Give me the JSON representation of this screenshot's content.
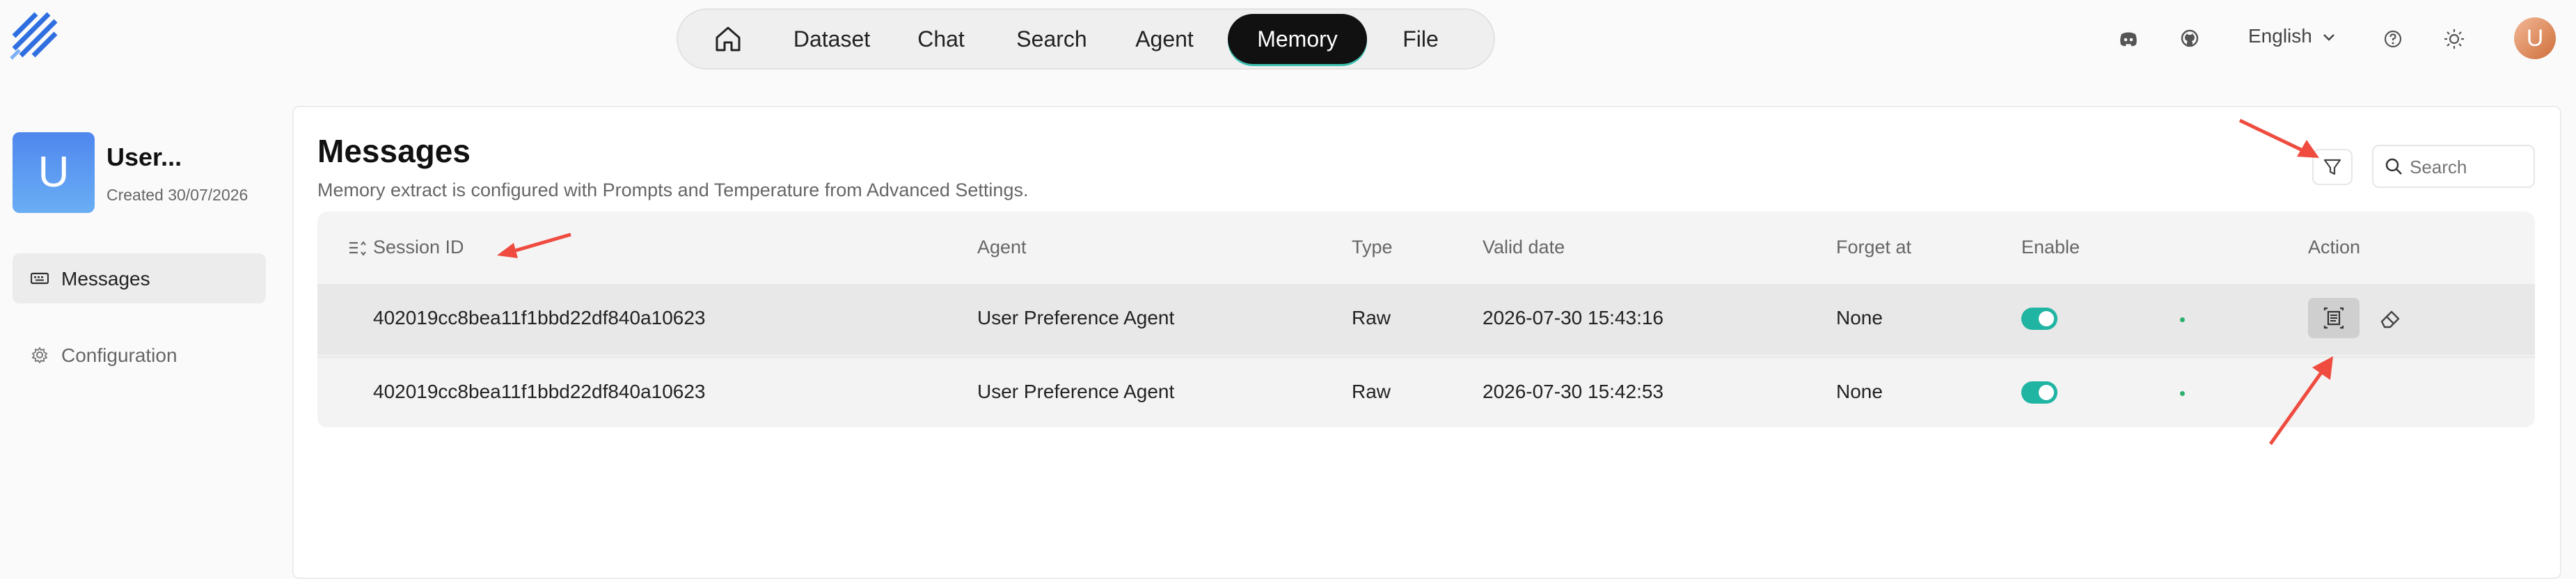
{
  "nav": {
    "items": [
      {
        "label": "Dataset"
      },
      {
        "label": "Chat"
      },
      {
        "label": "Search"
      },
      {
        "label": "Agent"
      },
      {
        "label": "Memory",
        "active": true
      },
      {
        "label": "File"
      }
    ]
  },
  "header": {
    "language": "English",
    "avatar_letter": "U"
  },
  "sidebar": {
    "avatar_letter": "U",
    "name": "User...",
    "created": "Created 30/07/2026",
    "items": [
      {
        "label": "Messages",
        "active": true
      },
      {
        "label": "Configuration",
        "active": false
      }
    ]
  },
  "main": {
    "title": "Messages",
    "subtitle": "Memory extract is configured with Prompts and Temperature from Advanced Settings.",
    "search_placeholder": "Search"
  },
  "table": {
    "headers": [
      "Session ID",
      "Agent",
      "Type",
      "Valid date",
      "Forget at",
      "Enable",
      "Action"
    ],
    "rows": [
      {
        "session_id": "402019cc8bea11f1bbd22df840a10623",
        "agent": "User Preference Agent",
        "type": "Raw",
        "valid_date": "2026-07-30 15:43:16",
        "forget_at": "None",
        "enabled": true
      },
      {
        "session_id": "402019cc8bea11f1bbd22df840a10623",
        "agent": "User Preference Agent",
        "type": "Raw",
        "valid_date": "2026-07-30 15:42:53",
        "forget_at": "None",
        "enabled": true
      }
    ]
  },
  "colors": {
    "accent": "#20b4a2",
    "active_nav_bg": "#111111",
    "avatar_gradient": [
      "#4f87ee",
      "#6aaef4"
    ],
    "annotation_arrow": "#ef4b3f"
  },
  "icons": [
    "logo-icon",
    "home-icon",
    "discord-icon",
    "github-icon",
    "chevron-down-icon",
    "help-icon",
    "sun-icon",
    "keyboard-icon",
    "gear-icon",
    "filter-icon",
    "search-icon",
    "sort-icon",
    "view-details-icon",
    "eraser-icon"
  ]
}
